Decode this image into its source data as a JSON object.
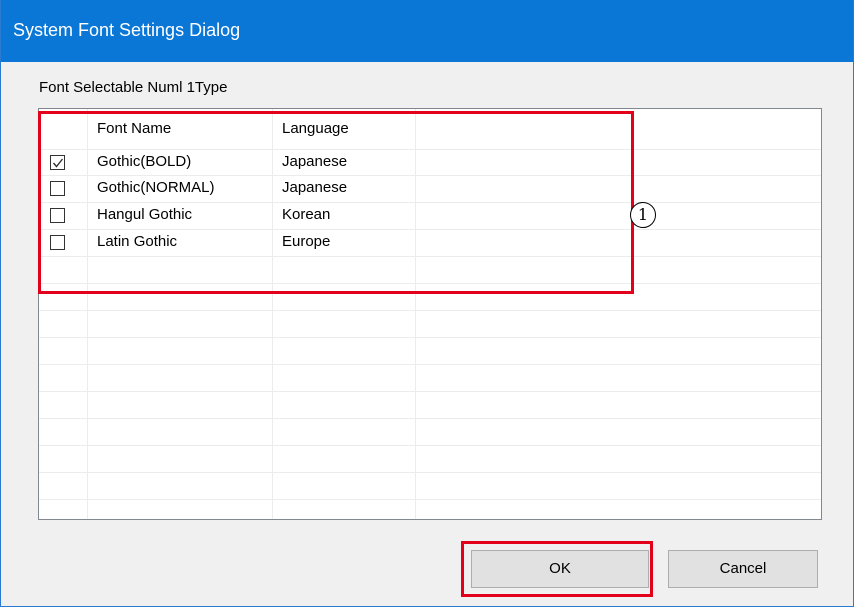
{
  "window": {
    "title": "System Font Settings Dialog"
  },
  "group": {
    "label": "Font Selectable Numl 1Type"
  },
  "list": {
    "columns": [
      "Font Name",
      "Language"
    ],
    "rows": [
      {
        "checked": true,
        "font_name": "Gothic(BOLD)",
        "language": "Japanese"
      },
      {
        "checked": false,
        "font_name": "Gothic(NORMAL)",
        "language": "Japanese"
      },
      {
        "checked": false,
        "font_name": "Hangul Gothic",
        "language": "Korean"
      },
      {
        "checked": false,
        "font_name": "Latin Gothic",
        "language": "Europe"
      }
    ]
  },
  "annotation": {
    "marker": "1",
    "highlight_color": "#e2001a"
  },
  "buttons": {
    "ok_label": "OK",
    "cancel_label": "Cancel"
  },
  "colors": {
    "titlebar": "#0a76d6"
  }
}
